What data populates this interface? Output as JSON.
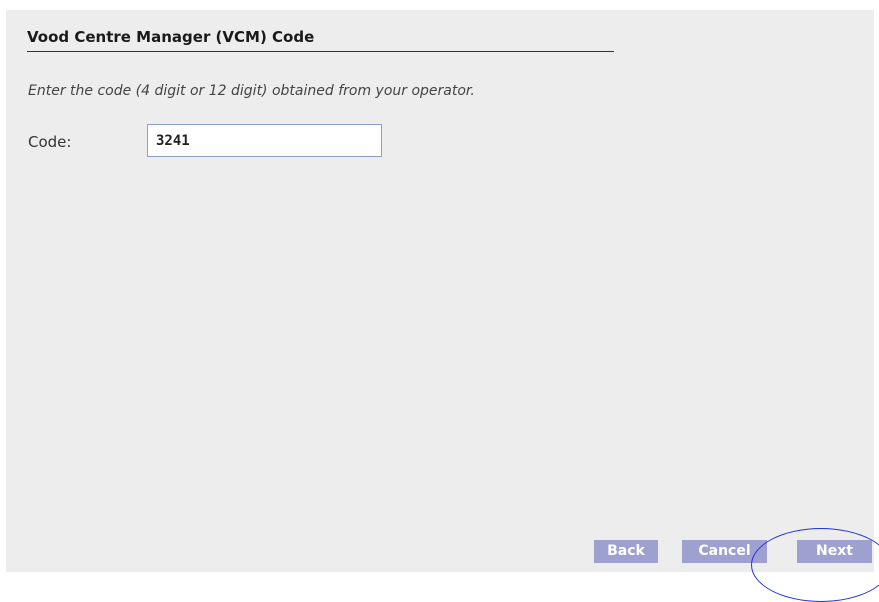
{
  "form": {
    "heading": "Vood Centre Manager (VCM) Code",
    "instruction": "Enter the code (4 digit or 12 digit) obtained from your operator.",
    "code_label": "Code:",
    "code_value": "3241"
  },
  "buttons": {
    "back": "Back",
    "cancel": "Cancel",
    "next": "Next"
  },
  "colors": {
    "panel_background": "#ededed",
    "button_background": "#9ea0d0",
    "button_text": "#ffffff",
    "annotation_circle": "#2233dd"
  }
}
